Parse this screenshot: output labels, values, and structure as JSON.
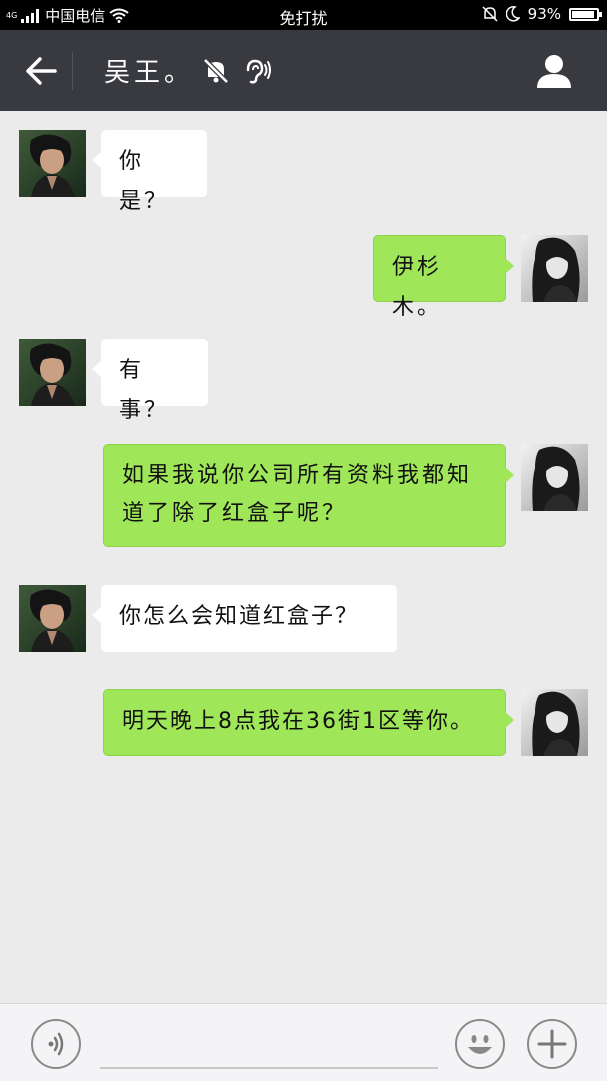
{
  "status_bar": {
    "network": "4G",
    "carrier": "中国电信",
    "mode": "免打扰",
    "battery": "93%",
    "battery_level": 0.93
  },
  "header": {
    "title": "吴王。",
    "icons": [
      "back-arrow-icon",
      "bell-muted-icon",
      "ear-icon",
      "profile-icon"
    ]
  },
  "messages": [
    {
      "side": "left",
      "text": "你是？"
    },
    {
      "side": "right",
      "text": "伊杉木。"
    },
    {
      "side": "left",
      "text": "有事？"
    },
    {
      "side": "right",
      "text": "如果我说你公司所有资料我都知道了除了红盒子呢？"
    },
    {
      "side": "left",
      "text": "你怎么会知道红盒子？"
    },
    {
      "side": "right",
      "text": "明天晚上8点我在36街1区等你。"
    }
  ],
  "input_bar": {
    "icons": [
      "voice-icon",
      "emoji-icon",
      "plus-icon"
    ]
  },
  "colors": {
    "header_bg": "#393a3f",
    "chat_bg": "#ebebeb",
    "my_bubble": "#9fe659",
    "their_bubble": "#ffffff"
  }
}
